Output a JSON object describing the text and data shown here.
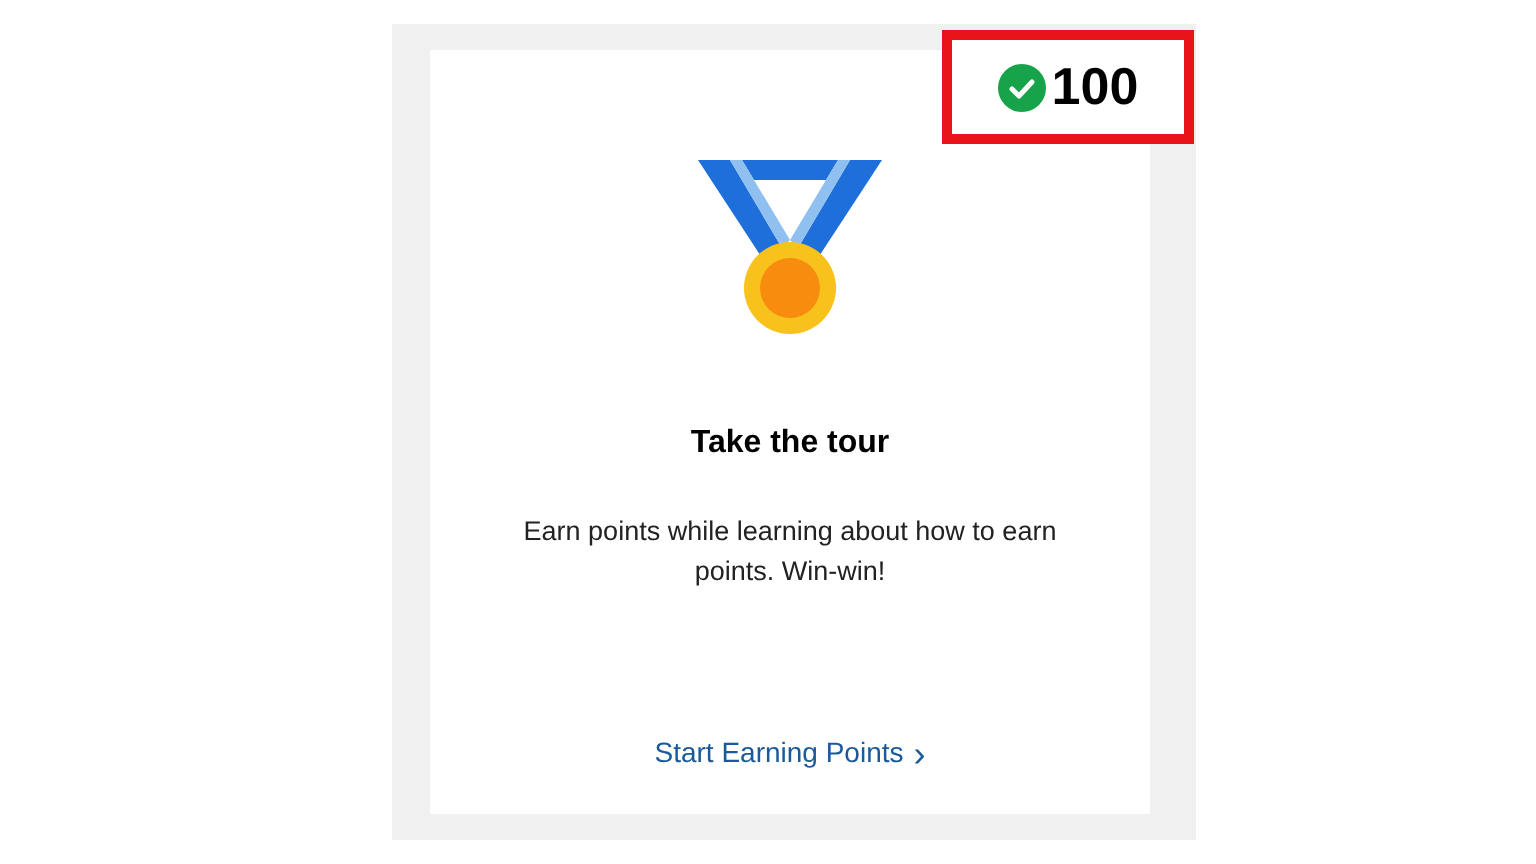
{
  "points_badge": {
    "value": "100",
    "completed": true
  },
  "card": {
    "title": "Take the tour",
    "description": "Earn points while learning about how to earn points. Win-win!",
    "link": "Start Earning Points",
    "link_chevron": "›"
  }
}
